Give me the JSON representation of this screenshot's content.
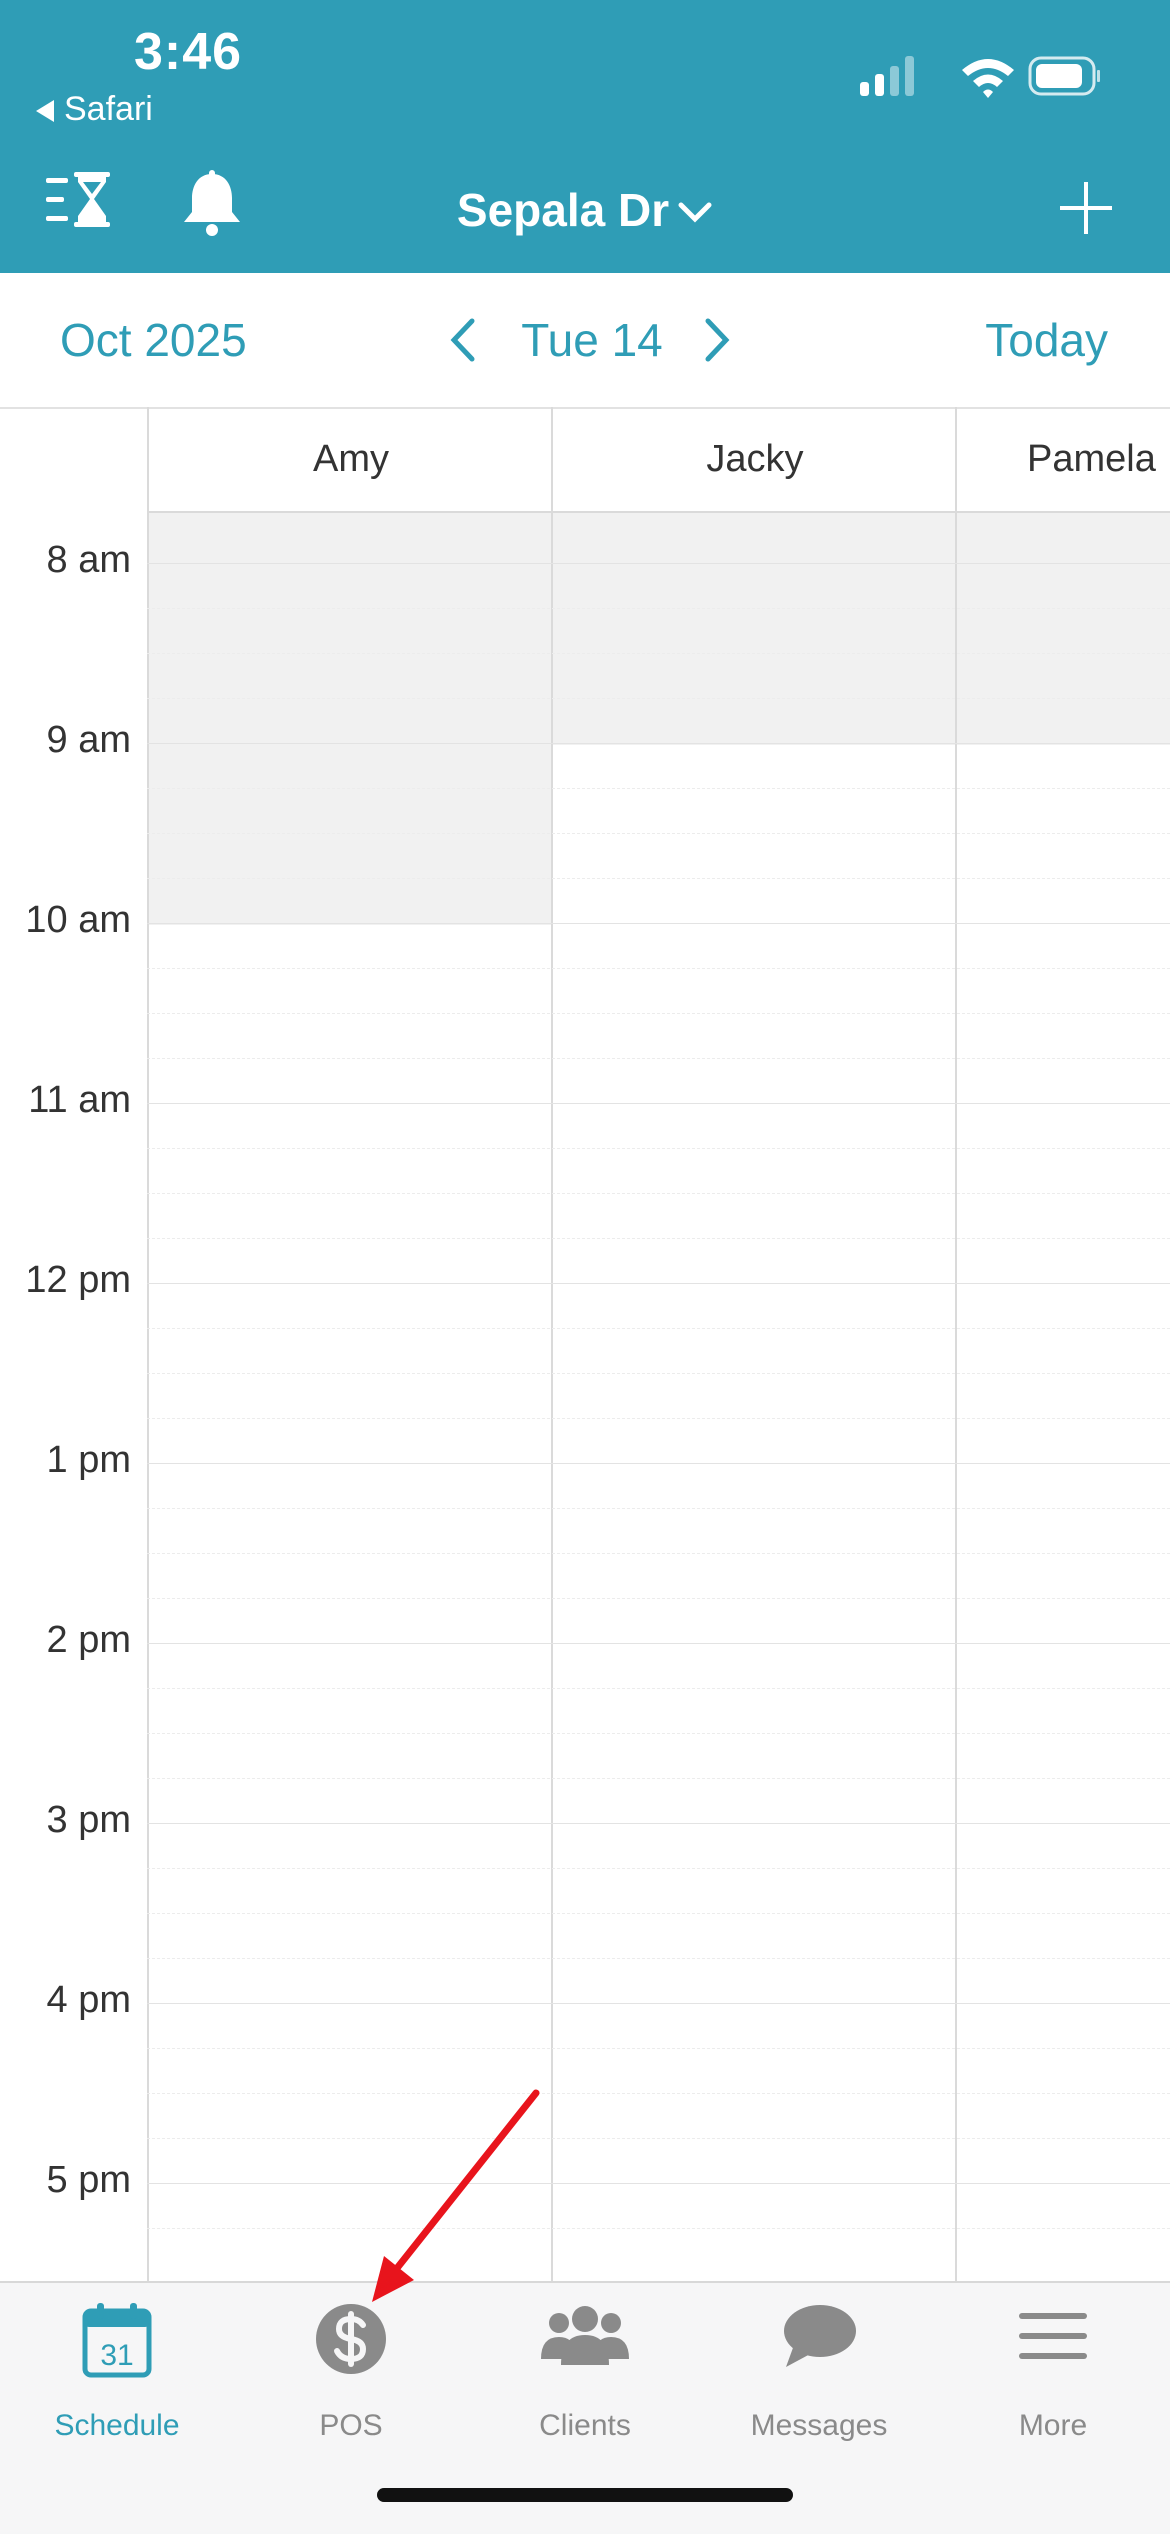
{
  "status_bar": {
    "time": "3:46",
    "back_app": "Safari"
  },
  "header": {
    "location": "Sepala Dr"
  },
  "date_nav": {
    "month": "Oct 2025",
    "day": "Tue 14",
    "today_label": "Today"
  },
  "staff_columns": [
    "Amy",
    "Jacky",
    "Pamela"
  ],
  "time_slots": [
    "8 am",
    "9 am",
    "10 am",
    "11 am",
    "12 pm",
    "1 pm",
    "2 pm",
    "3 pm",
    "4 pm",
    "5 pm"
  ],
  "tab_bar": {
    "items": [
      {
        "label": "Schedule",
        "icon": "calendar-icon",
        "active": true,
        "date_number": "31"
      },
      {
        "label": "POS",
        "icon": "dollar-icon",
        "active": false
      },
      {
        "label": "Clients",
        "icon": "people-icon",
        "active": false
      },
      {
        "label": "Messages",
        "icon": "chat-bubble-icon",
        "active": false
      },
      {
        "label": "More",
        "icon": "hamburger-icon",
        "active": false
      }
    ]
  },
  "colors": {
    "accent": "#2F9DB6",
    "annotation_arrow": "#E8141C",
    "unavailable": "#F1F1F1"
  }
}
